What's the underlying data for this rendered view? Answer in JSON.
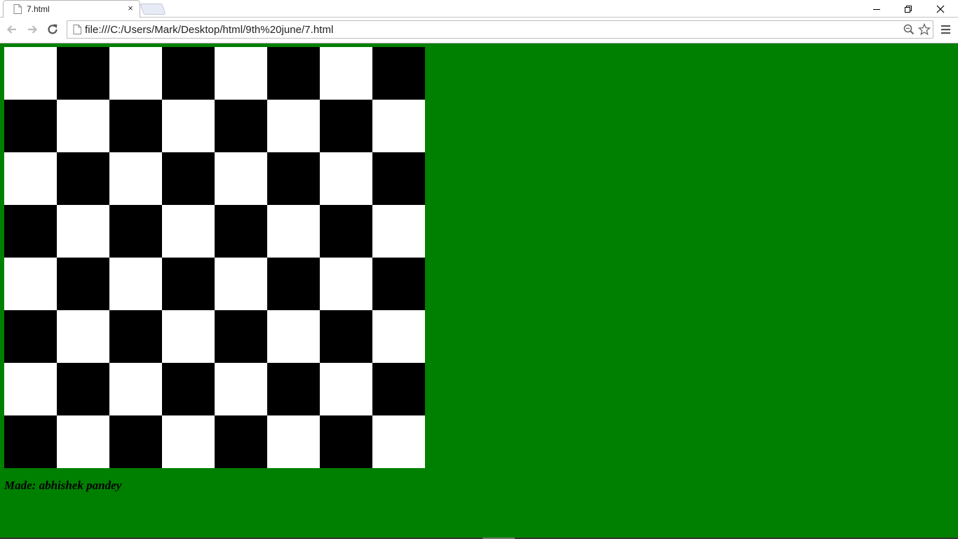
{
  "browser": {
    "tab": {
      "title": "7.html",
      "close_glyph": "×",
      "icon": "page-icon"
    },
    "window_controls": [
      "minimize-icon",
      "restore-icon",
      "close-icon"
    ],
    "nav": [
      "back-icon",
      "forward-icon",
      "reload-icon"
    ],
    "address_bar": {
      "url": "file:///C:/Users/Mark/Desktop/html/9th%20june/7.html",
      "icons": [
        "page-icon",
        "zoom-icon",
        "bookmark-star-icon"
      ]
    },
    "menu_icon": "hamburger-menu-icon"
  },
  "page": {
    "background_color": "#008000",
    "board": {
      "rows": 8,
      "cols": 8,
      "first_square_color": "white",
      "colors": {
        "light": "#ffffff",
        "dark": "#000000"
      }
    },
    "credit": "Made: abhishek pandey"
  }
}
